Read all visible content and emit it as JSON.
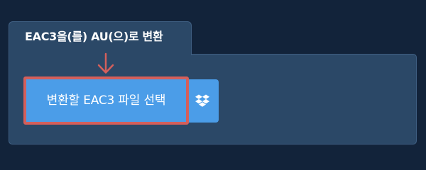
{
  "converter": {
    "title": "EAC3을(를) AU(으)로 변환",
    "choose_file_label": "변환할 EAC3 파일 선택",
    "dropbox_icon": "dropbox-icon",
    "arrow_icon": "arrow-down-icon"
  },
  "colors": {
    "page_background": "#12233a",
    "panel_background": "#2b4867",
    "button_blue": "#4b9de8",
    "highlight_red": "#d45f5b"
  }
}
